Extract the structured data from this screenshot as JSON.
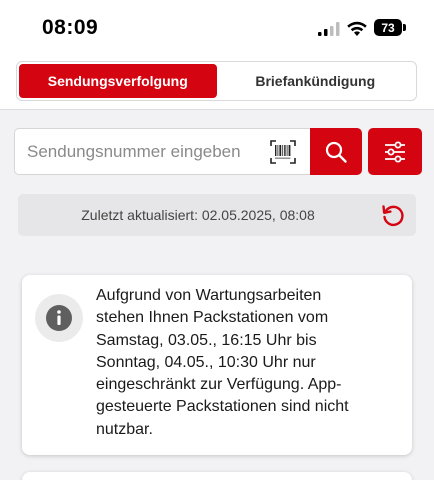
{
  "status_bar": {
    "time": "08:09",
    "battery": "73"
  },
  "tabs": [
    {
      "label": "Sendungsverfolgung",
      "active": true
    },
    {
      "label": "Briefankündigung",
      "active": false
    }
  ],
  "search": {
    "placeholder": "Sendungsnummer eingeben"
  },
  "updated": {
    "text": "Zuletzt aktualisiert: 02.05.2025, 08:08"
  },
  "notice": {
    "lines": [
      "Aufgrund von Wartungsarbeiten",
      "stehen Ihnen Packstationen vom",
      "Samstag, 03.05., 16:15 Uhr bis",
      "Sonntag, 04.05., 10:30 Uhr nur",
      "eingeschränkt zur Verfügung. App-",
      "gesteuerte Packstationen sind nicht",
      "nutzbar."
    ]
  },
  "icons": {
    "signal": "signal-icon",
    "wifi": "wifi-icon",
    "barcode": "barcode-scan-icon",
    "search": "search-icon",
    "filter": "filter-sliders-icon",
    "refresh": "refresh-icon",
    "info": "info-icon"
  },
  "colors": {
    "brand_red": "#d40511",
    "background": "#f2f2f4"
  }
}
